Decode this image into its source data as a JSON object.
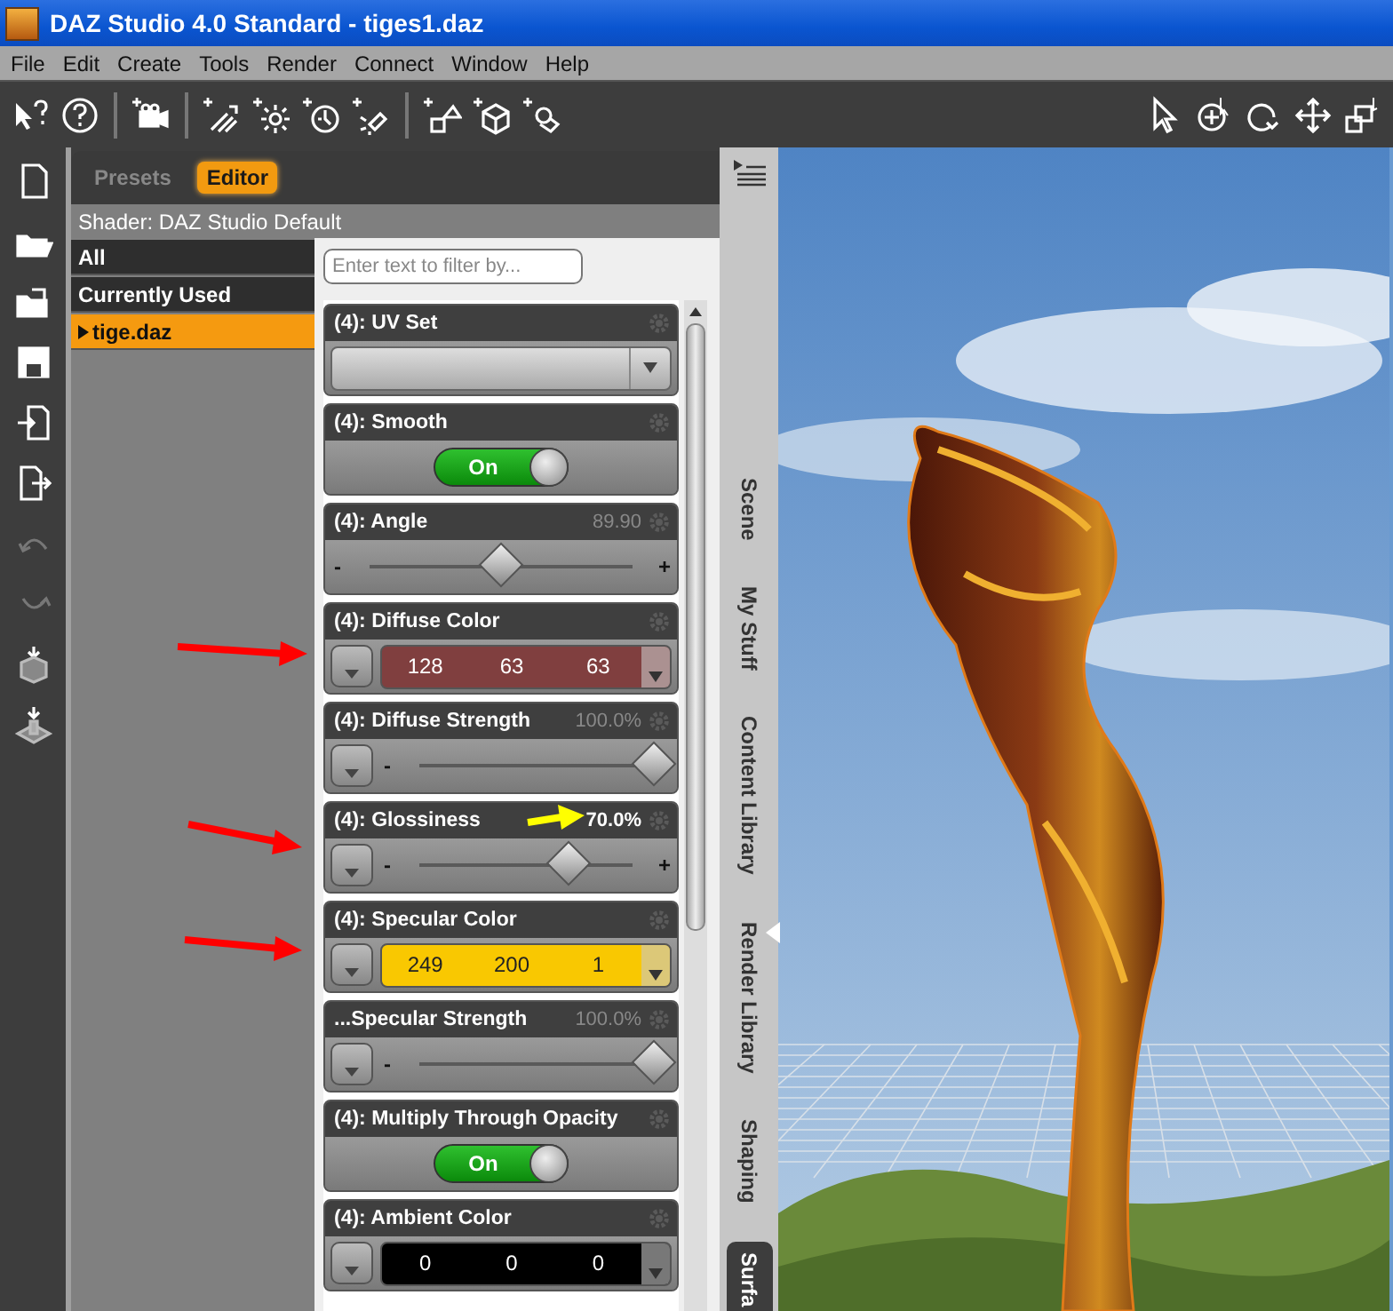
{
  "window": {
    "title": "DAZ Studio 4.0 Standard - tiges1.daz"
  },
  "menu": [
    "File",
    "Edit",
    "Create",
    "Tools",
    "Render",
    "Connect",
    "Window",
    "Help"
  ],
  "panel": {
    "tabs": [
      {
        "label": "Presets",
        "selected": false
      },
      {
        "label": "Editor",
        "selected": true
      }
    ],
    "shader": "Shader: DAZ Studio Default",
    "groups": [
      {
        "label": "All",
        "selected": false,
        "expandable": false
      },
      {
        "label": "Currently Used",
        "selected": false,
        "expandable": false
      },
      {
        "label": "tige.daz",
        "selected": true,
        "expandable": true
      }
    ],
    "filter": {
      "placeholder": "Enter text to filter by..."
    },
    "properties": [
      {
        "kind": "menu",
        "label": "(4): UV Set"
      },
      {
        "kind": "toggle",
        "label": "(4): Smooth",
        "on": true,
        "state_label": "On"
      },
      {
        "kind": "slider",
        "label": "(4): Angle",
        "reading": "89.90",
        "modified": false,
        "level": 0.5,
        "map_button": false,
        "min_label": "-",
        "max_label": "+"
      },
      {
        "kind": "color",
        "label": "(4): Diffuse Color",
        "values": [
          "128",
          "63",
          "63"
        ],
        "color": "#803f3f",
        "map_button": true
      },
      {
        "kind": "slider",
        "label": "(4): Diffuse Strength",
        "reading": "100.0%",
        "modified": false,
        "level": 1,
        "map_button": true,
        "min_label": "-"
      },
      {
        "kind": "slider",
        "label": "(4): Glossiness",
        "reading": "70.0%",
        "modified": true,
        "level": 0.7,
        "map_button": true,
        "min_label": "-",
        "max_label": "+"
      },
      {
        "kind": "color",
        "label": "(4): Specular Color",
        "values": [
          "249",
          "200",
          "1"
        ],
        "color": "#f9c801",
        "map_button": true
      },
      {
        "kind": "slider",
        "label": "...Specular Strength",
        "reading": "100.0%",
        "modified": false,
        "level": 1,
        "map_button": true,
        "min_label": "-"
      },
      {
        "kind": "toggle",
        "label": "(4): Multiply Through Opacity",
        "on": true,
        "state_label": "On"
      },
      {
        "kind": "color",
        "label": "(4): Ambient Color",
        "values": [
          "0",
          "0",
          "0"
        ],
        "color": "#000000",
        "map_button": true
      }
    ]
  },
  "side_tabs": [
    {
      "label": "Scene",
      "selected": false
    },
    {
      "label": "My Stuff",
      "selected": false
    },
    {
      "label": "Content Library",
      "selected": false
    },
    {
      "label": "Render Library",
      "selected": false
    },
    {
      "label": "Shaping",
      "selected": false
    },
    {
      "label": "Surfa",
      "selected": true
    }
  ]
}
